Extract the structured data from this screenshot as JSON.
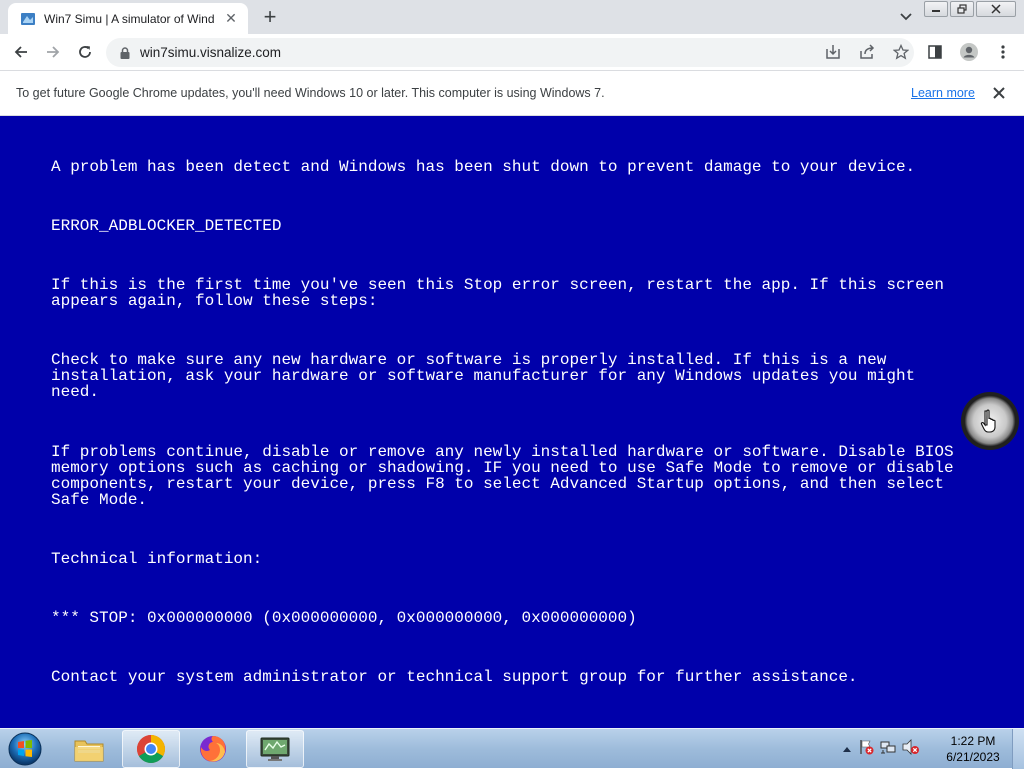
{
  "browser": {
    "tab": {
      "title": "Win7 Simu | A simulator of Wind",
      "favicon": "win7simu-favicon-icon",
      "close_glyph": "✕"
    },
    "new_tab_glyph": "+",
    "url": "win7simu.visnalize.com"
  },
  "infobar": {
    "message": "To get future Google Chrome updates, you'll need Windows 10 or later. This computer is using Windows 7.",
    "link": "Learn more"
  },
  "bsod": {
    "background": "#0000aa",
    "line1": "A problem has been detect and Windows has been shut down to prevent damage to your device.",
    "error_code": "ERROR_ADBLOCKER_DETECTED",
    "para_restart": "If this is the first time you've seen this Stop error screen, restart the app. If this screen\nappears again, follow these steps:",
    "para_check": "Check to make sure any new hardware or software is properly installed. If this is a new\ninstallation, ask your hardware or software manufacturer for any Windows updates you might\nneed.",
    "para_problems": "If problems continue, disable or remove any newly installed hardware or software. Disable BIOS\nmemory options such as caching or shadowing. IF you need to use Safe Mode to remove or disable\ncomponents, restart your device, press F8 to select Advanced Startup options, and then select\nSafe Mode.",
    "tech_header": "Technical information:",
    "stop_code": "*** STOP: 0x000000000 (0x000000000, 0x000000000, 0x000000000)",
    "contact": "Contact your system administrator or technical support group for further assistance."
  },
  "taskbar": {
    "apps": [
      "file-explorer-icon",
      "chrome-icon",
      "firefox-icon",
      "win7simu-app-icon"
    ],
    "clock_time": "1:22 PM",
    "clock_date": "6/21/2023"
  }
}
